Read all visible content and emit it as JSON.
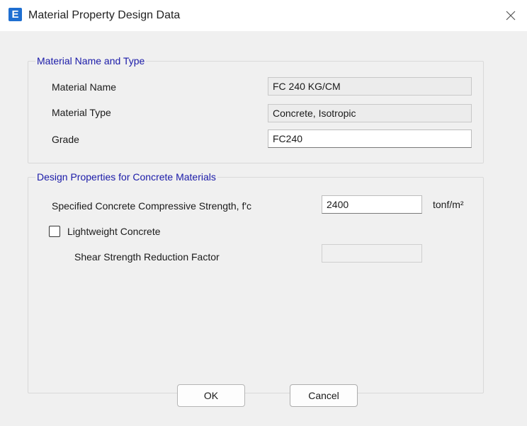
{
  "window": {
    "app_icon_letter": "E",
    "title": "Material Property Design Data"
  },
  "material_group": {
    "legend": "Material Name and Type",
    "name_label": "Material Name",
    "name_value": "FC 240 KG/CM",
    "type_label": "Material Type",
    "type_value": "Concrete, Isotropic",
    "grade_label": "Grade",
    "grade_value": "FC240"
  },
  "design_group": {
    "legend": "Design Properties for Concrete Materials",
    "fc_label": "Specified Concrete Compressive Strength, f'c",
    "fc_value": "2400",
    "fc_unit": "tonf/m²",
    "lightweight_label": "Lightweight Concrete",
    "lightweight_checked": false,
    "shear_label": "Shear Strength Reduction Factor",
    "shear_value": ""
  },
  "buttons": {
    "ok": "OK",
    "cancel": "Cancel"
  }
}
